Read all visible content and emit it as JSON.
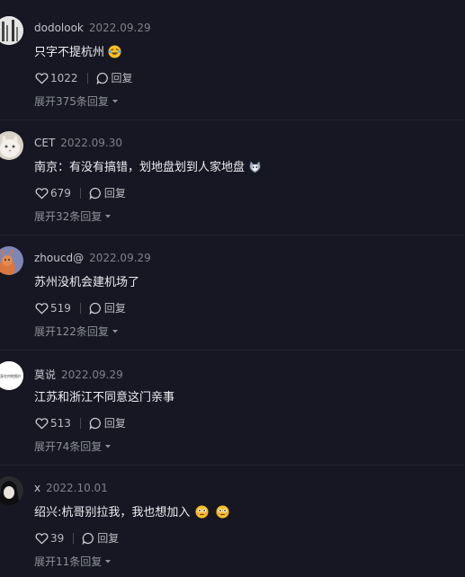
{
  "reply_label": "回复",
  "comments": [
    {
      "username": "dodolook",
      "date": "2022.09.29",
      "text": "只字不提杭州",
      "emoji": "laughing-crying-emoji",
      "likes": "1022",
      "expand": "展开375条回复"
    },
    {
      "username": "CET",
      "date": "2022.09.30",
      "text": "南京：有没有搞错，划地盘划到人家地盘",
      "emoji": "cat-emoji",
      "likes": "679",
      "expand": "展开32条回复"
    },
    {
      "username": "zhoucd@",
      "date": "2022.09.29",
      "text": "苏州没机会建机场了",
      "emoji": "",
      "likes": "519",
      "expand": "展开122条回复"
    },
    {
      "username": "莫说",
      "date": "2022.09.29",
      "text": "江苏和浙江不同意这门亲事",
      "emoji": "",
      "likes": "513",
      "expand": "展开74条回复"
    },
    {
      "username": "x",
      "date": "2022.10.01",
      "text": "绍兴:杭哥别拉我，我也想加入",
      "emoji": "flushed-emoji",
      "likes": "39",
      "expand": "展开11条回复"
    }
  ],
  "avatars": [
    "gray-figure-avatar",
    "white-kitten-avatar",
    "deer-cartoon-avatar",
    "white-text-avatar",
    "dark-anime-avatar"
  ],
  "avatar_4_text": "身在何地图片"
}
